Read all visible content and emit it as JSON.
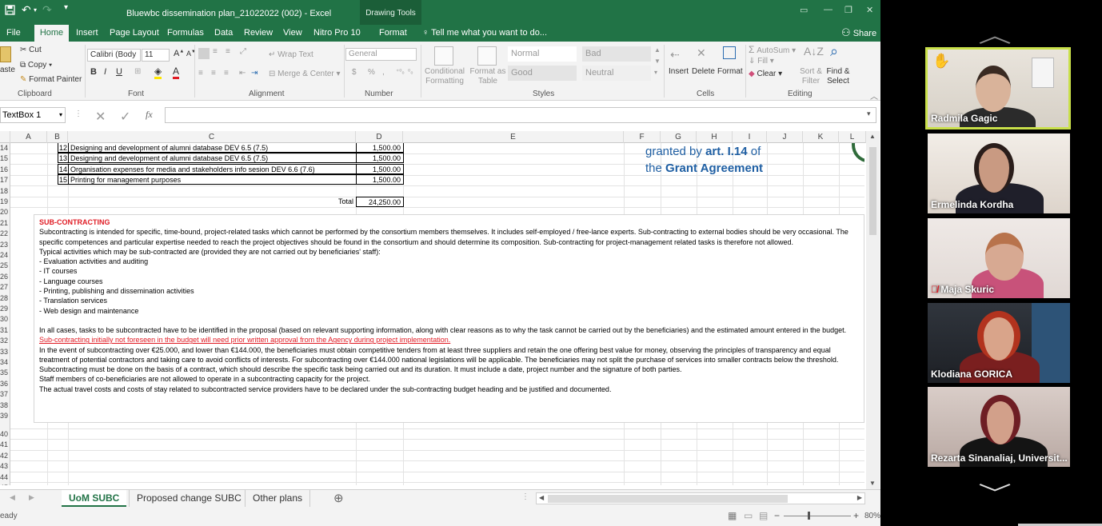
{
  "window": {
    "title": "Bluewbc dissemination plan_21022022 (002) - Excel",
    "context_tab": "Drawing Tools"
  },
  "menu": {
    "tabs": [
      "File",
      "Home",
      "Insert",
      "Page Layout",
      "Formulas",
      "Data",
      "Review",
      "View",
      "Nitro Pro 10",
      "Format"
    ],
    "tellme": "Tell me what you want to do...",
    "share": "Share"
  },
  "ribbon": {
    "clipboard": {
      "paste": "aste",
      "cut": "Cut",
      "copy": "Copy",
      "format_painter": "Format Painter",
      "label": "Clipboard"
    },
    "font": {
      "name": "Calibri (Body",
      "size": "11",
      "label": "Font",
      "bold": "B",
      "italic": "I",
      "underline": "U"
    },
    "alignment": {
      "wrap": "Wrap Text",
      "merge": "Merge & Center",
      "label": "Alignment"
    },
    "number": {
      "format": "General",
      "currency": "$",
      "percent": "%",
      "comma": ",",
      "label": "Number"
    },
    "styles": {
      "conditional": "Conditional Formatting",
      "format_table": "Format as Table",
      "normal": "Normal",
      "bad": "Bad",
      "good": "Good",
      "neutral": "Neutral",
      "label": "Styles"
    },
    "cells": {
      "insert": "Insert",
      "delete": "Delete",
      "format": "Format",
      "label": "Cells"
    },
    "editing": {
      "autosum": "AutoSum",
      "fill": "Fill",
      "clear": "Clear",
      "sort": "Sort & Filter",
      "find": "Find & Select",
      "label": "Editing"
    }
  },
  "formula_bar": {
    "name_box": "TextBox 1",
    "fx": "fx",
    "value": ""
  },
  "columns": [
    "A",
    "B",
    "C",
    "D",
    "E",
    "F",
    "G",
    "H",
    "I",
    "J",
    "K",
    "L"
  ],
  "rows": [
    "14",
    "15",
    "16",
    "17",
    "18",
    "19",
    "20",
    "21",
    "22",
    "23",
    "24",
    "25",
    "26",
    "27",
    "28",
    "29",
    "30",
    "31",
    "32",
    "33",
    "34",
    "35",
    "36",
    "37",
    "38",
    "39",
    "40",
    "41",
    "42",
    "43",
    "44",
    "45"
  ],
  "table": [
    {
      "no": "12",
      "desc": "Designing and development of alumni database DEV 6.5 (7.5)",
      "amount": "1,500.00"
    },
    {
      "no": "13",
      "desc": "Designing and development of alumni database DEV 6.5 (7.5)",
      "amount": "1,500.00"
    },
    {
      "no": "14",
      "desc": "Organisation expenses for media and stakeholders info sesion DEV 6.6 (7.6)",
      "amount": "1,500.00"
    },
    {
      "no": "15",
      "desc": "Printing for management purposes",
      "amount": "1,500.00"
    }
  ],
  "total": {
    "label": "Total",
    "value": "24,250.00"
  },
  "grant_note": {
    "line1": "granted by",
    "art": "art. I.14",
    "of": "of",
    "line2": "the",
    "agreement": "Grant Agreement"
  },
  "textbox": {
    "heading": "SUB-CONTRACTING",
    "p1": "Subcontracting is intended for specific, time-bound, project-related tasks which cannot be performed by the consortium members themselves. It includes self-employed / free-lance experts. Sub-contracting to external bodies should be very occasional. The specific competences and particular expertise needed to reach the project objectives should be found in the  consortium and should determine its composition. Sub-contracting for project-management related tasks is therefore not allowed.",
    "p2": "Typical activities which may be sub-contracted are (provided they are not carried out by beneficiaries' staff):",
    "list": [
      "- Evaluation activities and auditing",
      "- IT courses",
      "- Language courses",
      "- Printing, publishing and dissemination activities",
      "- Translation services",
      "- Web design and maintenance"
    ],
    "p3": "In all cases, tasks to be subcontracted have to be identified in the proposal (based on relevant supporting information, along with clear reasons as to why the task cannot be carried out by the beneficiaries) and the estimated amount entered in the budget.",
    "p3_red": "Sub-contracting initially not foreseen in the budget will need prior written approval from the Agency during project implementation.",
    "p4": "In the event of subcontracting over €25.000, and lower than €144.000, the beneficiaries must obtain competitive tenders from at least three suppliers and retain the one offering best value for money, observing the principles of transparency and equal treatment of potential contractors and taking care to avoid conflicts of interests. For subcontracting over €144.000 national legislations will be applicable. The beneficiaries may not split the purchase of services into smaller contracts below the threshold.",
    "p5": "Subcontracting must be done on the basis of a contract, which should describe the specific task being carried out and its duration. It must include a date, project number and the signature of both parties.",
    "p6": "Staff members of co-beneficiaries are not allowed to operate in a subcontracting capacity for the project.",
    "p7": "The actual travel costs and costs of stay related to subcontracted service providers have to be declared under the sub-contracting budget heading and be justified and documented."
  },
  "sheets": [
    "UoM SUBC",
    "Proposed change SUBC",
    "Other plans"
  ],
  "status": {
    "ready": "eady",
    "zoom": "80%"
  },
  "participants": [
    {
      "name": "Radmila Gagic",
      "highlight": true,
      "hand_raised": true
    },
    {
      "name": "Ermelinda Kordha"
    },
    {
      "name": "Maja Skuric",
      "muted": true
    },
    {
      "name": "Klodiana GORICA"
    },
    {
      "name": "Rezarta Sinanaliaj, Universit..."
    }
  ],
  "colors": {
    "excel_green": "#217346",
    "red_text": "#e01b24",
    "grant_blue": "#1f5fa3",
    "speaker_highlight": "#c9e04a"
  }
}
